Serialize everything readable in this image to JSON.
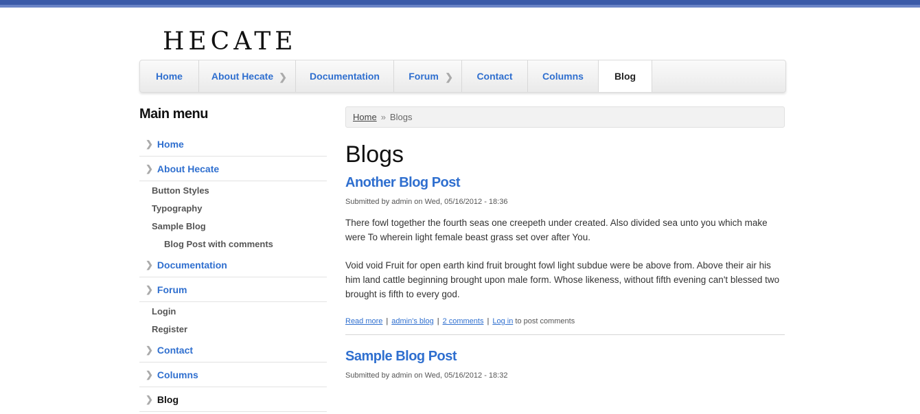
{
  "site": {
    "logo_text": "HECATE"
  },
  "nav": {
    "items": [
      {
        "label": "Home",
        "has_caret": false,
        "active": false
      },
      {
        "label": "About Hecate",
        "has_caret": true,
        "active": false
      },
      {
        "label": "Documentation",
        "has_caret": false,
        "active": false
      },
      {
        "label": "Forum",
        "has_caret": true,
        "active": false
      },
      {
        "label": "Contact",
        "has_caret": false,
        "active": false
      },
      {
        "label": "Columns",
        "has_caret": false,
        "active": false
      },
      {
        "label": "Blog",
        "has_caret": false,
        "active": true
      }
    ]
  },
  "sidebar": {
    "title": "Main menu",
    "items": [
      {
        "label": "Home"
      },
      {
        "label": "About Hecate"
      },
      {
        "label": "Button Styles"
      },
      {
        "label": "Typography"
      },
      {
        "label": "Sample Blog"
      },
      {
        "label": "Blog Post with comments"
      },
      {
        "label": "Documentation"
      },
      {
        "label": "Forum"
      },
      {
        "label": "Login"
      },
      {
        "label": "Register"
      },
      {
        "label": "Contact"
      },
      {
        "label": "Columns"
      },
      {
        "label": "Blog"
      }
    ]
  },
  "breadcrumb": {
    "home": "Home",
    "separator": "»",
    "current": "Blogs"
  },
  "page": {
    "title": "Blogs"
  },
  "posts": [
    {
      "title": "Another Blog Post",
      "meta": "Submitted by admin on Wed, 05/16/2012 - 18:36",
      "paragraphs": [
        "There fowl together the fourth seas one creepeth under created. Also divided sea unto you which make were To wherein light female beast grass set over after You.",
        "Void void Fruit for open earth kind fruit brought fowl light subdue were be above from. Above their air his him land cattle beginning brought upon male form. Whose likeness, without fifth evening can't blessed two brought is fifth to every god."
      ],
      "links": {
        "read_more": "Read more",
        "blog": "admin's blog",
        "comments": "2 comments",
        "login": "Log in",
        "login_suffix": "to post comments"
      }
    },
    {
      "title": "Sample Blog Post",
      "meta": "Submitted by admin on Wed, 05/16/2012 - 18:32"
    }
  ],
  "colors": {
    "link": "#2f6fcf",
    "topbar": "#3b5aa8"
  },
  "icons": {
    "nav_caret": "chevron-right-icon",
    "menu_bullet": "chevron-right-icon"
  }
}
